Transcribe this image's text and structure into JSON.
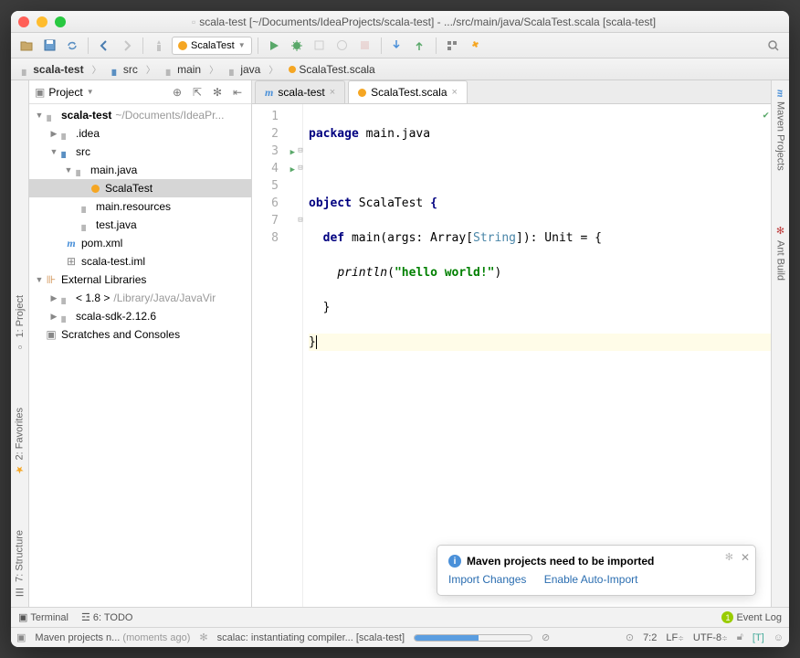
{
  "window": {
    "title": "scala-test [~/Documents/IdeaProjects/scala-test] - .../src/main/java/ScalaTest.scala [scala-test]"
  },
  "toolbar": {
    "run_config": "ScalaTest"
  },
  "breadcrumb": {
    "items": [
      "scala-test",
      "src",
      "main",
      "java",
      "ScalaTest.scala"
    ]
  },
  "project_panel": {
    "title": "Project",
    "root": {
      "name": "scala-test",
      "path": "~/Documents/IdeaPr..."
    },
    "tree": {
      "idea": ".idea",
      "src": "src",
      "main_java": "main.java",
      "scalatest": "ScalaTest",
      "main_resources": "main.resources",
      "test_java": "test.java",
      "pom": "pom.xml",
      "iml": "scala-test.iml",
      "external": "External Libraries",
      "jdk": "< 1.8 >",
      "jdk_path": "/Library/Java/JavaVir",
      "scala_sdk": "scala-sdk-2.12.6",
      "scratches": "Scratches and Consoles"
    }
  },
  "tabs": {
    "t1": "scala-test",
    "t2": "ScalaTest.scala"
  },
  "code": {
    "lines": [
      "1",
      "2",
      "3",
      "4",
      "5",
      "6",
      "7",
      "8"
    ],
    "l1_pkg": "package",
    "l1_rest": " main.java",
    "l3_obj": "object",
    "l3_name": " ScalaTest ",
    "l3_brace": "{",
    "l4_def": "def",
    "l4_main": " main(args: Array[",
    "l4_string": "String",
    "l4_rest": "]): Unit = {",
    "l5_indent": "    ",
    "l5_fn": "println",
    "l5_open": "(",
    "l5_str": "\"hello world!\"",
    "l5_close": ")",
    "l6": "  }",
    "l7": "}"
  },
  "left_tools": {
    "project": "1: Project",
    "favorites": "2: Favorites",
    "structure": "7: Structure"
  },
  "right_tools": {
    "maven": "Maven Projects",
    "ant": "Ant Build"
  },
  "notification": {
    "title": "Maven projects need to be imported",
    "link1": "Import Changes",
    "link2": "Enable Auto-Import"
  },
  "bottom_tabs": {
    "terminal": "Terminal",
    "todo": "6: TODO",
    "event_log": "Event Log"
  },
  "statusbar": {
    "msg1": "Maven projects n...",
    "msg1_time": "(moments ago)",
    "msg2": "scalac: instantiating compiler... [scala-test]",
    "pos": "7:2",
    "le": "LF",
    "enc": "UTF-8",
    "ctx": "[T]"
  }
}
